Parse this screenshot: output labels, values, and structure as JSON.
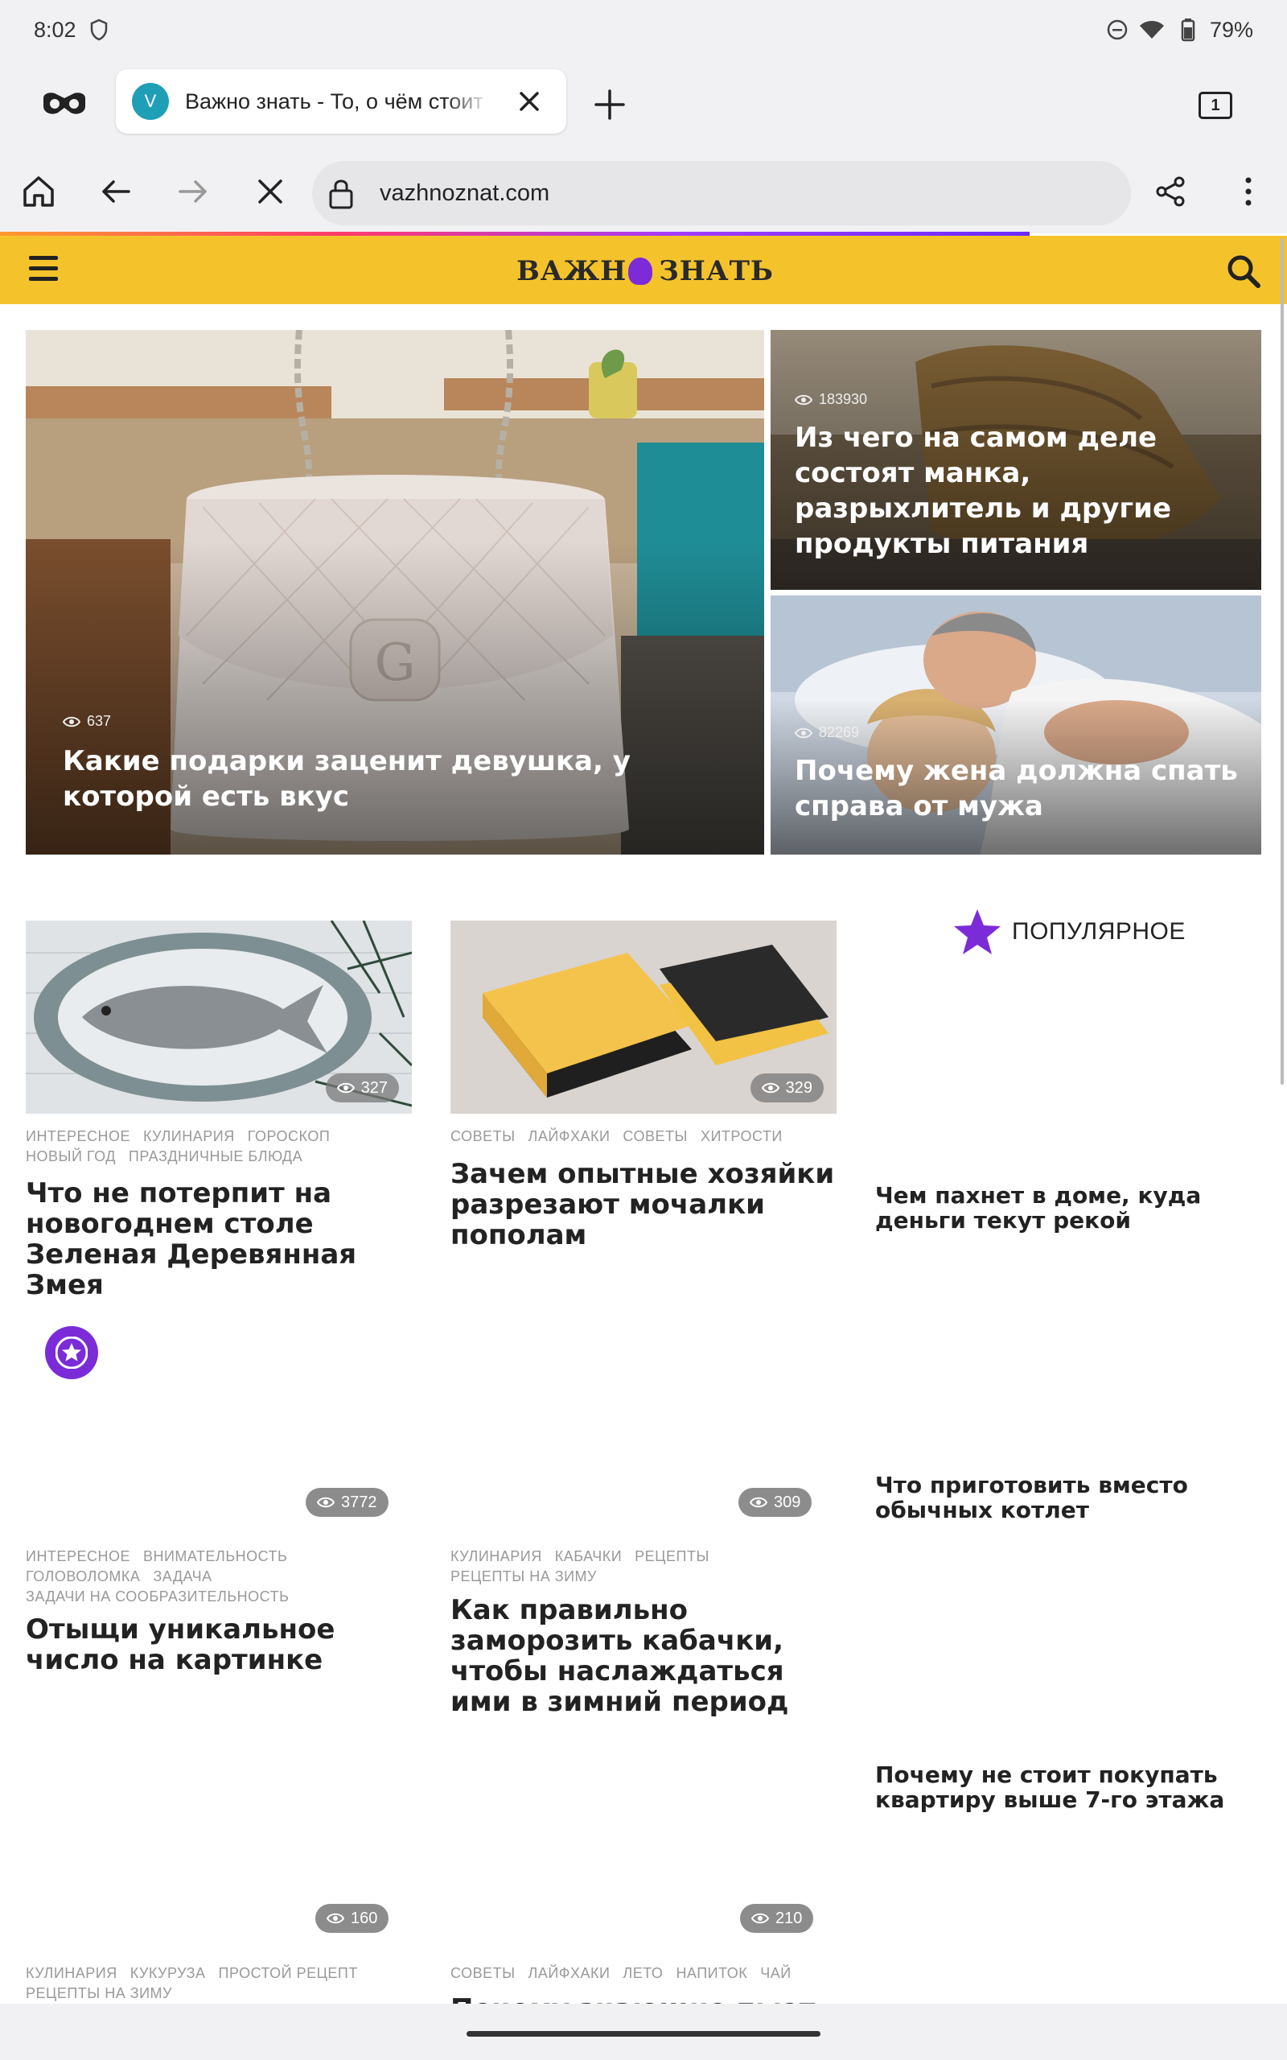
{
  "status": {
    "time": "8:02",
    "battery": "79%"
  },
  "browser": {
    "tab_favicon_letter": "V",
    "tab_title": "Важно знать - То, о чём стоит знать",
    "tab_count": "1",
    "url": "vazhnoznat.com"
  },
  "site": {
    "logo_left": "ВАЖН",
    "logo_right": "ЗНАТЬ"
  },
  "hero": {
    "main": {
      "views": "637",
      "title": "Какие подарки заценит девушка, у которой есть вкус"
    },
    "top_right": {
      "views": "183930",
      "title": "Из чего на самом деле состоят манка, разрыхлитель и другие продукты питания"
    },
    "bottom_right": {
      "views": "82269",
      "title": "Почему жена должна спать справа от мужа"
    }
  },
  "cards": [
    {
      "views": "327",
      "tags": [
        "ИНТЕРЕСНОЕ",
        "КУЛИНАРИЯ",
        "ГОРОСКОП",
        "НОВЫЙ ГОД",
        "ПРАЗДНИЧНЫЕ БЛЮДА"
      ],
      "title": "Что не потерпит на новогоднем столе Зеленая Деревянная Змея"
    },
    {
      "views": "329",
      "tags": [
        "СОВЕТЫ",
        "ЛАЙФХАКИ",
        "СОВЕТЫ",
        "ХИТРОСТИ"
      ],
      "title": "Зачем опытные хозяйки разрезают мочалки пополам"
    },
    {
      "views": "3772",
      "tags": [
        "ИНТЕРЕСНОЕ",
        "ВНИМАТЕЛЬНОСТЬ",
        "ГОЛОВОЛОМКА",
        "ЗАДАЧА",
        "ЗАДАЧИ НА СООБРАЗИТЕЛЬНОСТЬ"
      ],
      "title": "Отыщи уникальное число на картинке"
    },
    {
      "views": "309",
      "tags": [
        "КУЛИНАРИЯ",
        "КАБАЧКИ",
        "РЕЦЕПТЫ",
        "РЕЦЕПТЫ НА ЗИМУ"
      ],
      "title": "Как правильно заморозить кабачки, чтобы наслаждаться ими в зимний период"
    },
    {
      "views": "160",
      "tags": [
        "КУЛИНАРИЯ",
        "КУКУРУЗА",
        "ПРОСТОЙ РЕЦЕПТ",
        "РЕЦЕПТЫ НА ЗИМУ"
      ],
      "title": ""
    },
    {
      "views": "210",
      "tags": [
        "СОВЕТЫ",
        "ЛАЙФХАКИ",
        "ЛЕТО",
        "НАПИТОК",
        "ЧАЙ"
      ],
      "title": "Почему знающие пьют в..."
    }
  ],
  "popular": {
    "label": "ПОПУЛЯРНОЕ",
    "items": [
      "Чем пахнет в доме, куда деньги текут рекой",
      "Что приготовить вместо обычных котлет",
      "Почему не стоит покупать квартиру выше 7-го этажа"
    ]
  }
}
